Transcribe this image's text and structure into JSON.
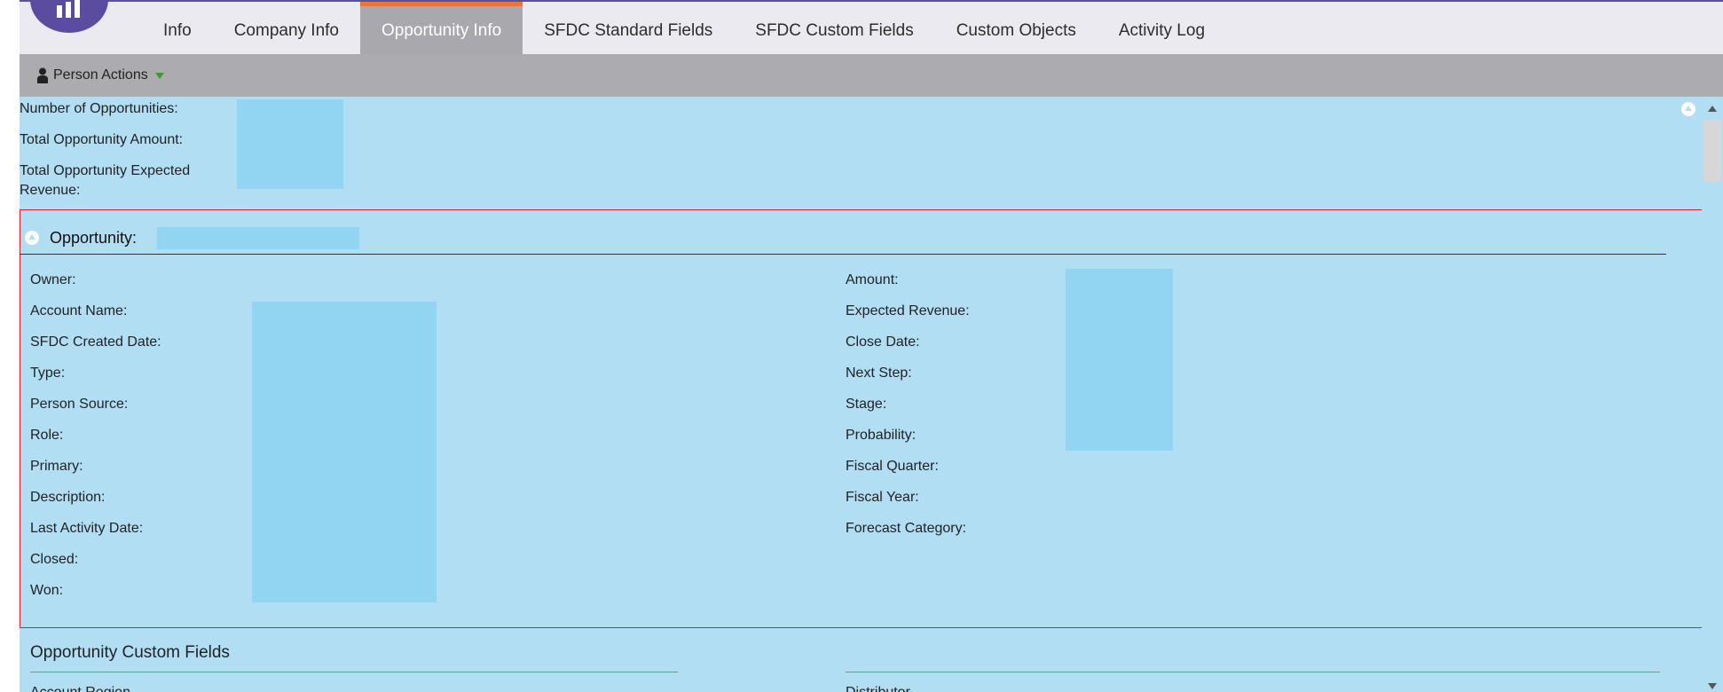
{
  "tabs": [
    {
      "label": "Info"
    },
    {
      "label": "Company Info"
    },
    {
      "label": "Opportunity Info",
      "active": true
    },
    {
      "label": "SFDC Standard Fields"
    },
    {
      "label": "SFDC Custom Fields"
    },
    {
      "label": "Custom Objects"
    },
    {
      "label": "Activity Log"
    }
  ],
  "toolbar": {
    "person_actions_label": "Person Actions"
  },
  "summary": {
    "num_opportunities_label": "Number of Opportunities:",
    "total_amount_label": "Total Opportunity Amount:",
    "total_expected_revenue_label_line1": "Total Opportunity Expected",
    "total_expected_revenue_label_line2": "Revenue:"
  },
  "opportunity": {
    "title": "Opportunity:",
    "left_fields": [
      "Owner:",
      "Account Name:",
      "SFDC Created Date:",
      "Type:",
      "Person Source:",
      "Role:",
      "Primary:",
      "Description:",
      "Last Activity Date:",
      "Closed:",
      "Won:"
    ],
    "right_fields": [
      "Amount:",
      "Expected Revenue:",
      "Close Date:",
      "Next Step:",
      "Stage:",
      "Probability:",
      "Fiscal Quarter:",
      "Fiscal Year:",
      "Forecast Category:"
    ]
  },
  "custom_fields": {
    "title": "Opportunity Custom Fields",
    "left_partial_label": "Account Region",
    "right_partial_label": "Distributor"
  },
  "colors": {
    "brand_purple": "#5b4ca0",
    "active_tab_accent": "#e97631",
    "content_background": "#b2def4",
    "redaction_mask": "#92d5f3",
    "highlight_border": "#d5232f"
  }
}
